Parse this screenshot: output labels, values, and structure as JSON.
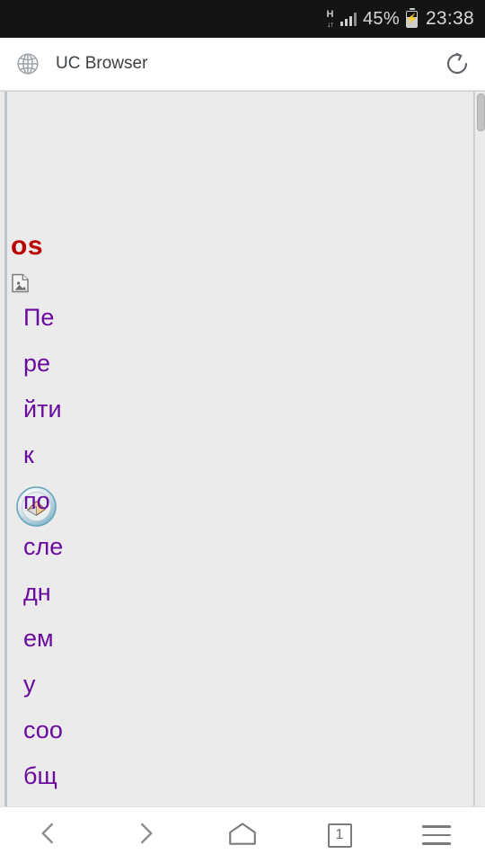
{
  "status_bar": {
    "network_type": "H",
    "network_arrows": "↓↑",
    "signal_icon": "signal-bars-icon",
    "battery_percent": "45%",
    "battery_icon": "battery-charging-icon",
    "time": "23:38",
    "background_color": "#141414"
  },
  "app_bar": {
    "globe_icon": "globe-icon",
    "title": "UC Browser",
    "reload_icon": "reload-icon"
  },
  "page": {
    "background_color": "#ebebeb",
    "brand_text": "os",
    "brand_color": "#bb0000",
    "broken_image_icon": "broken-image-icon",
    "post_icon": "last-post-badge-icon",
    "link_color": "#6a0b9e",
    "link_full_text": "Перейти к последнему сообщ",
    "link_lines": [
      "Пе",
      "ре",
      "йти",
      "к",
      "по",
      "сле",
      "дн",
      "ем",
      "у",
      "соо",
      "бщ"
    ],
    "scrollbar": "vertical-scrollbar"
  },
  "nav_bar": {
    "back_icon": "back-chevron-icon",
    "forward_icon": "forward-chevron-icon",
    "home_icon": "home-icon",
    "tab_count": "1",
    "menu_icon": "hamburger-menu-icon"
  }
}
